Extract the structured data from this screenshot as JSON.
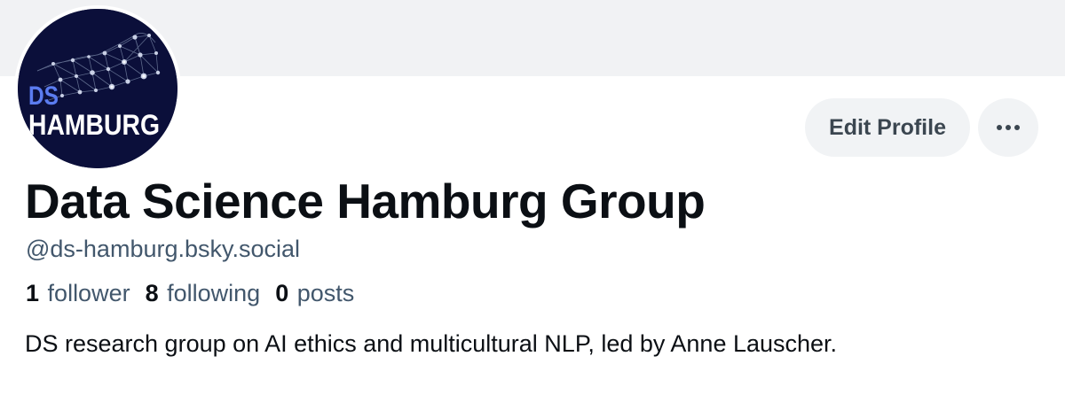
{
  "profile": {
    "avatar_text_top": "DS",
    "avatar_text_bottom": "HAMBURG",
    "display_name": "Data Science Hamburg Group",
    "handle": "@ds-hamburg.bsky.social",
    "bio": "DS research group on AI ethics and multicultural NLP, led by Anne Lauscher."
  },
  "actions": {
    "edit_profile_label": "Edit Profile",
    "more_icon": "ellipsis-icon"
  },
  "stats": [
    {
      "value": "1",
      "label": "follower"
    },
    {
      "value": "8",
      "label": "following"
    },
    {
      "value": "0",
      "label": "posts"
    }
  ],
  "colors": {
    "banner": "#f1f2f4",
    "avatar_background": "#0b0f3a",
    "avatar_ds_text": "#5b7cf0",
    "button_background": "#f1f3f5",
    "secondary_text": "#42576c"
  }
}
